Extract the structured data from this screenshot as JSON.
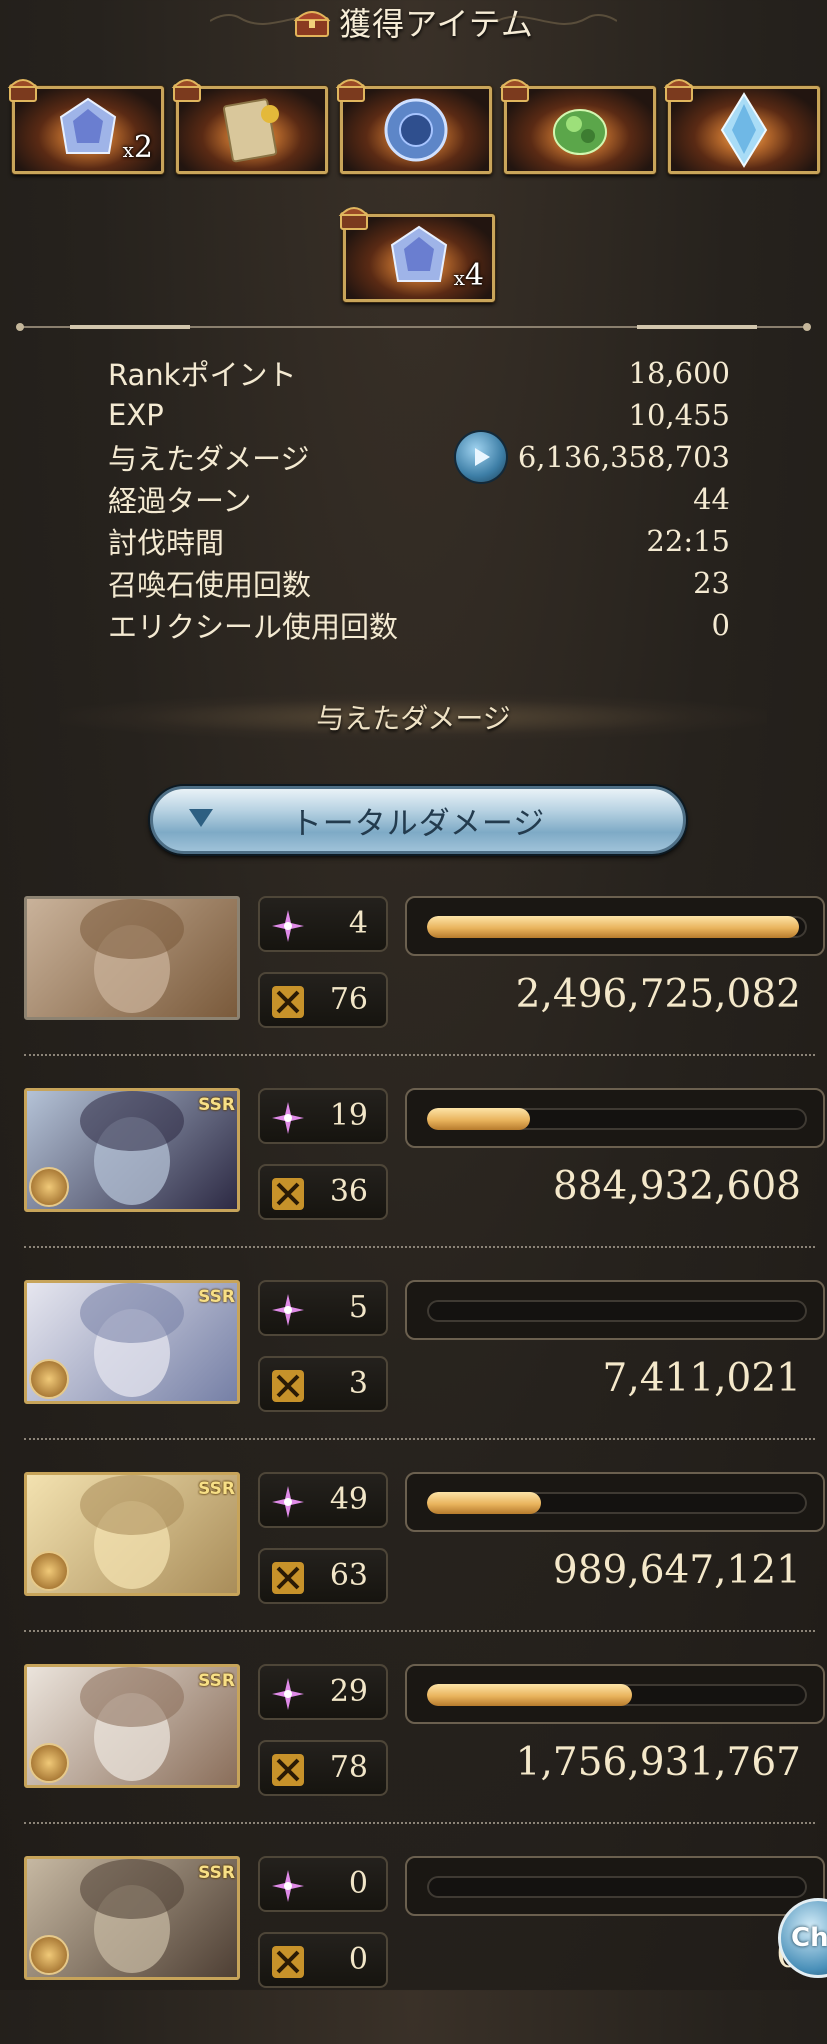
{
  "header": {
    "title": "獲得アイテム"
  },
  "items": [
    {
      "name": "crystal",
      "qty": "2"
    },
    {
      "name": "scroll",
      "qty": ""
    },
    {
      "name": "orb",
      "qty": ""
    },
    {
      "name": "green-stone",
      "qty": ""
    },
    {
      "name": "blue-crystal",
      "qty": ""
    },
    {
      "name": "crystal",
      "qty": "4"
    }
  ],
  "qty_prefix": "x",
  "stats": [
    {
      "label": "Rankポイント",
      "value": "18,600"
    },
    {
      "label": "EXP",
      "value": "10,455"
    },
    {
      "label": "与えたダメージ",
      "value": "6,136,358,703"
    },
    {
      "label": "経過ターン",
      "value": "44"
    },
    {
      "label": "討伐時間",
      "value": "22:15"
    },
    {
      "label": "召喚石使用回数",
      "value": "23"
    },
    {
      "label": "エリクシール使用回数",
      "value": "0"
    }
  ],
  "damage_section": {
    "heading": "与えたダメージ",
    "dropdown_label": "トータルダメージ"
  },
  "characters": [
    {
      "ssr": false,
      "skills": "4",
      "attacks": "76",
      "damage": "2,496,725,082",
      "bar_fill": 0.98,
      "colors": [
        "#c9b29a",
        "#7a5a3b"
      ]
    },
    {
      "ssr": true,
      "ssr_label": "SSR",
      "skills": "19",
      "attacks": "36",
      "damage": "884,932,608",
      "bar_fill": 0.27,
      "colors": [
        "#b4c2d6",
        "#2d2a44"
      ]
    },
    {
      "ssr": true,
      "ssr_label": "SSR",
      "skills": "5",
      "attacks": "3",
      "damage": "7,411,021",
      "bar_fill": 0.0,
      "colors": [
        "#e6e6ef",
        "#7680a6"
      ]
    },
    {
      "ssr": true,
      "ssr_label": "SSR",
      "skills": "49",
      "attacks": "63",
      "damage": "989,647,121",
      "bar_fill": 0.3,
      "colors": [
        "#f3e2b0",
        "#a98d5a"
      ]
    },
    {
      "ssr": true,
      "ssr_label": "SSR",
      "skills": "29",
      "attacks": "78",
      "damage": "1,756,931,767",
      "bar_fill": 0.54,
      "colors": [
        "#ebe4dc",
        "#8a6e5a"
      ]
    },
    {
      "ssr": true,
      "ssr_label": "SSR",
      "skills": "0",
      "attacks": "0",
      "damage": "0",
      "bar_fill": 0.0,
      "colors": [
        "#c6b8a2",
        "#4e3f34"
      ]
    }
  ],
  "chat_button": {
    "label": "Ch"
  }
}
